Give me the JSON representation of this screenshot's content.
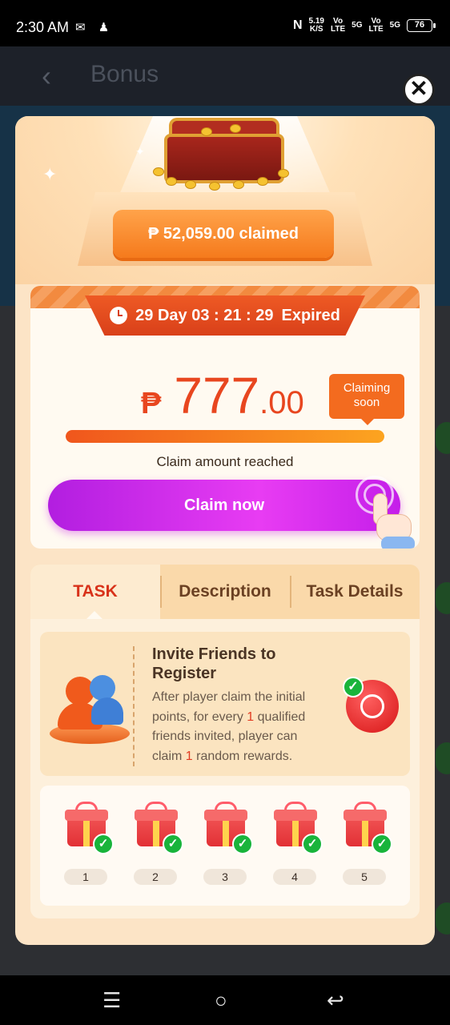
{
  "status_bar": {
    "time": "2:30 AM",
    "speed_value": "5.19",
    "speed_unit": "K/S",
    "net1_top": "Vo",
    "net1_bottom": "LTE",
    "net1_gen": "5G",
    "net2_top": "Vo",
    "net2_bottom": "LTE",
    "net2_gen": "5G",
    "battery": "76"
  },
  "app_bar": {
    "title": "Bonus",
    "back_icon": "‹"
  },
  "close_icon": "✕",
  "hero": {
    "claimed_text": "₱ 52,059.00 claimed"
  },
  "claim": {
    "timer_text": "29 Day 03 : 21 : 29",
    "expired_label": "Expired",
    "currency": "₱",
    "amount_int": "777",
    "amount_dec": ".00",
    "soon_line1": "Claiming",
    "soon_line2": "soon",
    "progress_fraction": 1.0,
    "reached_text": "Claim amount reached",
    "button_label": "Claim now"
  },
  "tabs": [
    {
      "label": "TASK",
      "active": true
    },
    {
      "label": "Description",
      "active": false
    },
    {
      "label": "Task Details",
      "active": false
    }
  ],
  "task": {
    "title": "Invite Friends to Register",
    "desc_part1": "After player claim the initial points, for every ",
    "count1": "1",
    "desc_part2": " qualified friends invited, player can claim ",
    "count2": "1",
    "desc_part3": " random rewards."
  },
  "gifts": [
    {
      "num": "1",
      "completed": true
    },
    {
      "num": "2",
      "completed": true
    },
    {
      "num": "3",
      "completed": true
    },
    {
      "num": "4",
      "completed": true
    },
    {
      "num": "5",
      "completed": true
    }
  ],
  "check_icon": "✓",
  "nav": {
    "menu_icon": "☰",
    "home_icon": "○",
    "back_icon": "↩"
  },
  "colors": {
    "accent_orange": "#f36b1f",
    "claim_button": "#e83cf3",
    "active_tab": "#d8321a",
    "success_green": "#19b43b"
  }
}
